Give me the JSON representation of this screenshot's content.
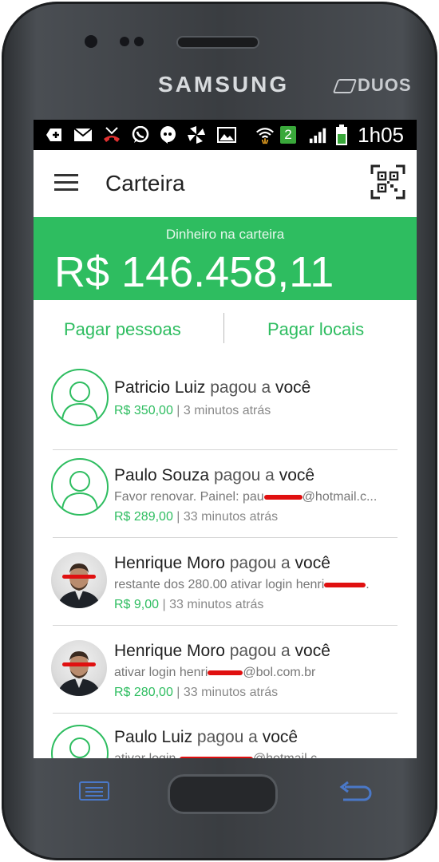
{
  "device": {
    "brand": "SAMSUNG",
    "model_badge": "DUOS"
  },
  "statusbar": {
    "icons": [
      "add-icon",
      "mail-icon",
      "missed-call-icon",
      "whatsapp-icon",
      "chat-bubble-icon",
      "sync-icon",
      "image-icon",
      "wifi-icon",
      "sim2-icon",
      "signal-icon",
      "battery-icon"
    ],
    "sim_number": "2",
    "time": "1h05"
  },
  "appbar": {
    "title": "Carteira"
  },
  "balance": {
    "label": "Dinheiro na carteira",
    "value": "R$ 146.458,11"
  },
  "actions": {
    "pay_people": "Pagar pessoas",
    "pay_places": "Pagar locais"
  },
  "feed": [
    {
      "name": "Patricio Luiz",
      "verb": "pagou a",
      "target": "você",
      "description": "",
      "amount": "R$ 350,00",
      "time": "3 minutos atrás",
      "avatar": "placeholder"
    },
    {
      "name": "Paulo Souza",
      "verb": "pagou a",
      "target": "você",
      "description_prefix": "Favor renovar. Painel: pau",
      "description_suffix": "@hotmail.c...",
      "amount": "R$ 289,00",
      "time": "33 minutos atrás",
      "avatar": "placeholder"
    },
    {
      "name": "Henrique Moro",
      "verb": "pagou a",
      "target": "você",
      "description_prefix": "restante dos 280.00 ativar login henri",
      "description_suffix": ".",
      "amount": "R$ 9,00",
      "time": "33 minutos atrás",
      "avatar": "photo"
    },
    {
      "name": "Henrique Moro",
      "verb": "pagou a",
      "target": "você",
      "description_prefix": "ativar login henri",
      "description_suffix": "@bol.com.br",
      "amount": "R$ 280,00",
      "time": "33 minutos atrás",
      "avatar": "photo"
    },
    {
      "name": "Paulo Luiz",
      "verb": "pagou a",
      "target": "você",
      "description_prefix": "ativar login ",
      "description_suffix": "@hotmail.c...",
      "amount": "",
      "time": "",
      "avatar": "placeholder"
    }
  ],
  "colors": {
    "accent": "#2ebd60",
    "redaction": "#e01010"
  }
}
